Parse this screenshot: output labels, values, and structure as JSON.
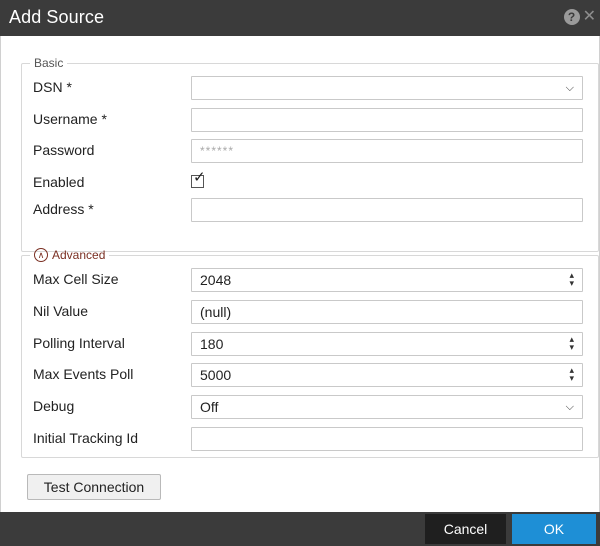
{
  "dialog": {
    "title": "Add Source",
    "help_icon": "?",
    "close_icon": "✕"
  },
  "basic": {
    "legend": "Basic",
    "fields": [
      {
        "label": "DSN *",
        "type": "select",
        "value": ""
      },
      {
        "label": "Username *",
        "type": "text",
        "value": ""
      },
      {
        "label": "Password",
        "type": "password",
        "value": "******"
      },
      {
        "label": "Enabled",
        "type": "checkbox",
        "checked": true
      },
      {
        "label": "Address *",
        "type": "text",
        "value": ""
      }
    ]
  },
  "advanced": {
    "legend": "Advanced",
    "fields": [
      {
        "label": "Max Cell Size",
        "type": "spinner",
        "value": "2048"
      },
      {
        "label": "Nil Value",
        "type": "text",
        "value": "(null)"
      },
      {
        "label": "Polling Interval",
        "type": "spinner",
        "value": "180"
      },
      {
        "label": "Max Events Poll",
        "type": "spinner",
        "value": "5000"
      },
      {
        "label": "Debug",
        "type": "select",
        "value": "Off"
      },
      {
        "label": "Initial Tracking Id",
        "type": "text",
        "value": ""
      }
    ]
  },
  "actions": {
    "test_connection": "Test Connection",
    "cancel": "Cancel",
    "ok": "OK"
  },
  "colors": {
    "titlebar": "#3b3b3b",
    "ok_button": "#1e8fd6",
    "cancel_button": "#1f1f1f",
    "advanced_accent": "#7a2f22"
  }
}
